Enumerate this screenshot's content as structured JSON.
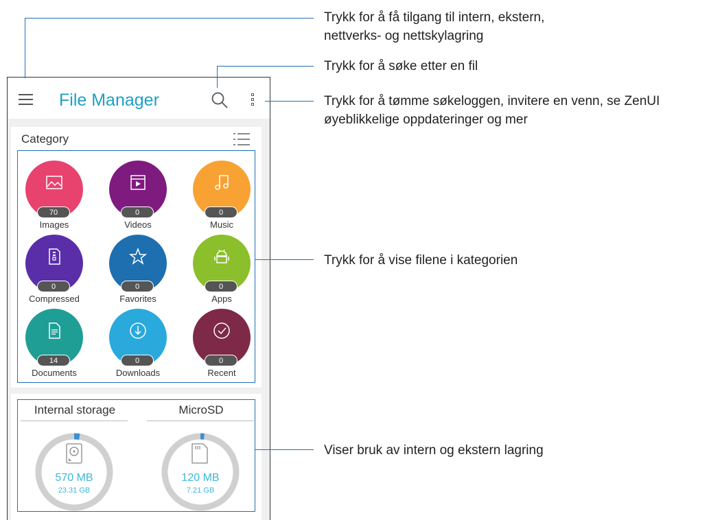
{
  "app": {
    "title": "File Manager"
  },
  "toolbar": {
    "menu_icon": "hamburger-menu-icon",
    "search_icon": "search-icon",
    "overflow_icon": "overflow-menu-icon"
  },
  "category": {
    "title": "Category",
    "view_icon": "list-view-icon",
    "items": [
      {
        "label": "Images",
        "count": "70",
        "color": "#e8426f",
        "icon": "image-icon"
      },
      {
        "label": "Videos",
        "count": "0",
        "color": "#7f1a7f",
        "icon": "video-icon"
      },
      {
        "label": "Music",
        "count": "0",
        "color": "#f7a233",
        "icon": "music-icon"
      },
      {
        "label": "Compressed",
        "count": "0",
        "color": "#5a2ea8",
        "icon": "zip-file-icon"
      },
      {
        "label": "Favorites",
        "count": "0",
        "color": "#1e6fb0",
        "icon": "star-icon"
      },
      {
        "label": "Apps",
        "count": "0",
        "color": "#8bbf2b",
        "icon": "android-icon"
      },
      {
        "label": "Documents",
        "count": "14",
        "color": "#1f9e96",
        "icon": "document-icon"
      },
      {
        "label": "Downloads",
        "count": "0",
        "color": "#2aa9dc",
        "icon": "download-icon"
      },
      {
        "label": "Recent",
        "count": "0",
        "color": "#7d2947",
        "icon": "check-circle-icon"
      }
    ]
  },
  "storage": {
    "internal": {
      "label": "Internal storage",
      "used": "570 MB",
      "total": "23.31 GB",
      "used_fraction": 0.024,
      "icon": "hard-drive-icon"
    },
    "sd": {
      "label": "MicroSD",
      "used": "120 MB",
      "total": "7.21 GB",
      "used_fraction": 0.017,
      "icon": "sd-card-icon"
    }
  },
  "callouts": {
    "menu_line1": "Trykk for å få tilgang til intern, ekstern,",
    "menu_line2": "nettverks- og nettskylagring",
    "search": "Trykk for å søke etter en fil",
    "overflow_line1": "Trykk for å tømme søkeloggen, invitere en venn, se ZenUI",
    "overflow_line2": "øyeblikkelige oppdateringer og mer",
    "category": "Trykk for å vise filene i kategorien",
    "storage": "Viser bruk av intern og ekstern lagring"
  },
  "colors": {
    "accent": "#1f9fc4",
    "callout_line": "#1f6fb3",
    "storage_ring": "#d0d0d0",
    "storage_used": "#3a8fd6"
  }
}
